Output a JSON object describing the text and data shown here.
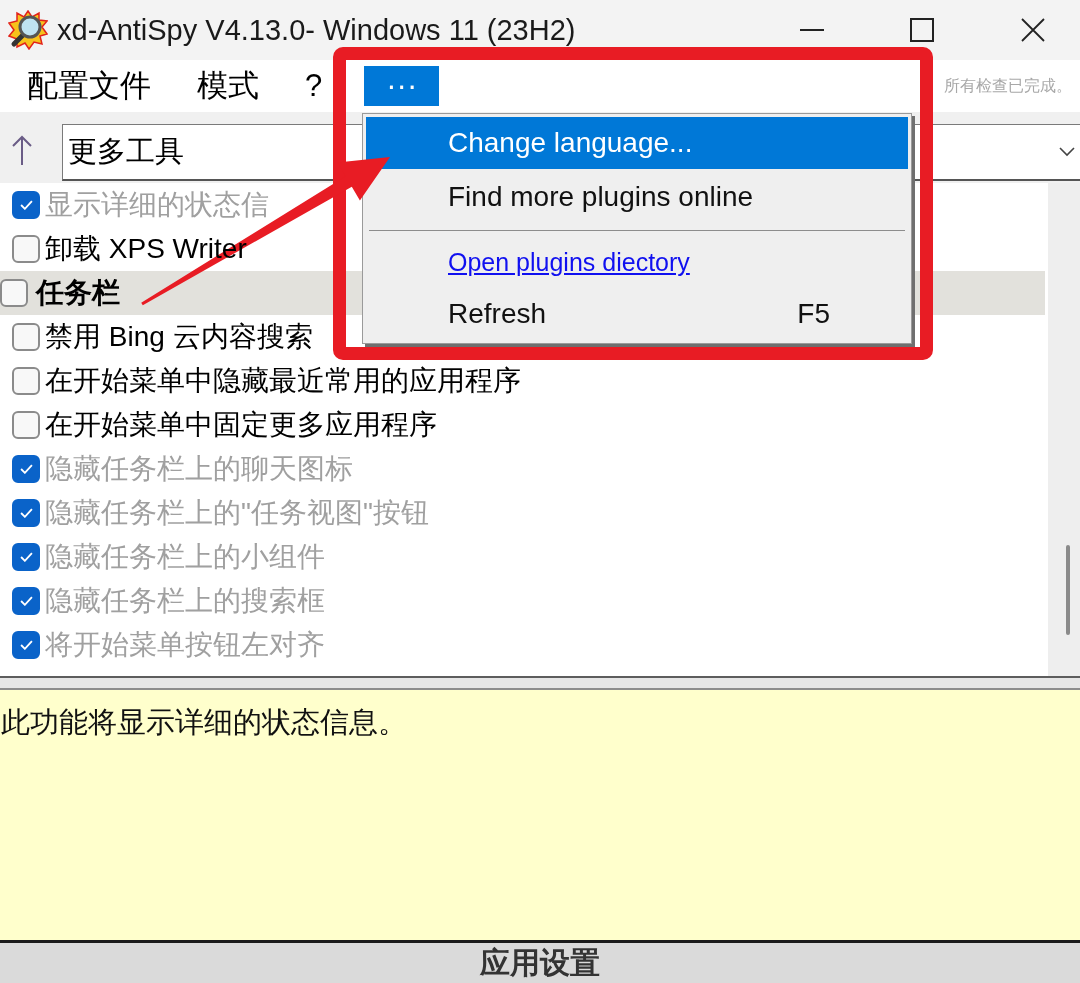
{
  "window": {
    "title": "xd-AntiSpy V4.13.0- Windows 11 (23H2)"
  },
  "menu_bar": {
    "menus": [
      {
        "label": "配置文件",
        "selected": false
      },
      {
        "label": "模式",
        "selected": false
      },
      {
        "label": "?",
        "selected": false
      },
      {
        "label": "···",
        "selected": true
      }
    ],
    "status": "所有检查已完成。"
  },
  "toolbar": {
    "category": "更多工具"
  },
  "settings": [
    {
      "kind": "option",
      "label": "显示详细的状态信",
      "checked": true
    },
    {
      "kind": "option",
      "label": "卸载 XPS Writer",
      "checked": false
    },
    {
      "kind": "group",
      "label": "任务栏",
      "checked": false
    },
    {
      "kind": "option",
      "label": "禁用 Bing 云内容搜索",
      "checked": false
    },
    {
      "kind": "option",
      "label": "在开始菜单中隐藏最近常用的应用程序",
      "checked": false
    },
    {
      "kind": "option",
      "label": "在开始菜单中固定更多应用程序",
      "checked": false
    },
    {
      "kind": "option",
      "label": "隐藏任务栏上的聊天图标",
      "checked": true
    },
    {
      "kind": "option",
      "label": "隐藏任务栏上的\"任务视图\"按钮",
      "checked": true
    },
    {
      "kind": "option",
      "label": "隐藏任务栏上的小组件",
      "checked": true
    },
    {
      "kind": "option",
      "label": "隐藏任务栏上的搜索框",
      "checked": true
    },
    {
      "kind": "option",
      "label": "将开始菜单按钮左对齐",
      "checked": true
    }
  ],
  "description": "此功能将显示详细的状态信息。",
  "apply_button": "应用设置",
  "dropdown_menu": {
    "items": [
      {
        "kind": "item",
        "label": "Change language...",
        "selected": true
      },
      {
        "kind": "item",
        "label": "Find more plugins online",
        "selected": false
      },
      {
        "kind": "separator"
      },
      {
        "kind": "link",
        "label": "Open plugins diectory",
        "selected": false
      },
      {
        "kind": "item",
        "label": "Refresh",
        "shortcut": "F5",
        "selected": false
      }
    ]
  }
}
